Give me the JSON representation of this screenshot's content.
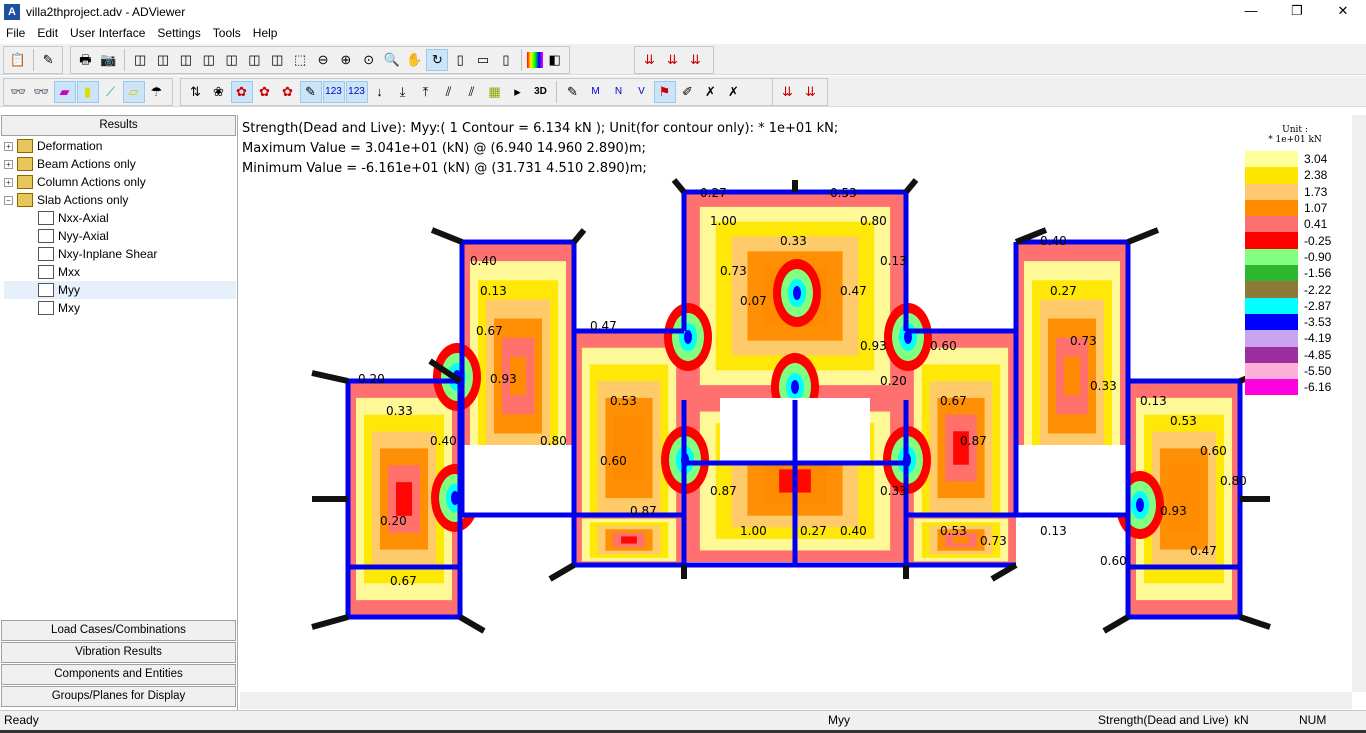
{
  "window": {
    "title": "villa2thproject.adv - ADViewer",
    "minimize": "—",
    "restore": "❐",
    "close": "✕"
  },
  "menu": [
    "File",
    "Edit",
    "User Interface",
    "Settings",
    "Tools",
    "Help"
  ],
  "panel": {
    "results_label": "Results",
    "tree": [
      {
        "label": "Deformation",
        "level": 0
      },
      {
        "label": "Beam Actions only",
        "level": 0
      },
      {
        "label": "Column Actions only",
        "level": 0
      },
      {
        "label": "Slab Actions only",
        "level": 0
      },
      {
        "label": "Nxx-Axial",
        "level": 1
      },
      {
        "label": "Nyy-Axial",
        "level": 1
      },
      {
        "label": "Nxy-Inplane Shear",
        "level": 1
      },
      {
        "label": "Mxx",
        "level": 1
      },
      {
        "label": "Myy",
        "level": 1
      },
      {
        "label": "Mxy",
        "level": 1
      }
    ],
    "bottom_tabs": [
      "Load Cases/Combinations",
      "Vibration Results",
      "Components and Entities",
      "Groups/Planes for Display"
    ]
  },
  "canvas": {
    "header_line1": "Strength(Dead and Live): Myy:( 1 Contour = 6.134 kN ); Unit(for contour only): * 1e+01 kN;",
    "header_line2": "Maximum Value = 3.041e+01 (kN) @ (6.940 14.960 2.890)m;",
    "header_line3": "Minimum Value = -6.161e+01 (kN) @ (31.731 4.510 2.890)m;",
    "legend_title": "Unit :",
    "legend_unit": "* 1e+01 kN",
    "legend": [
      {
        "value": "3.04",
        "color": "#ffff99"
      },
      {
        "value": "2.38",
        "color": "#ffe600"
      },
      {
        "value": "1.73",
        "color": "#ffc870"
      },
      {
        "value": "1.07",
        "color": "#ff8c00"
      },
      {
        "value": "0.41",
        "color": "#ff7070"
      },
      {
        "value": "-0.25",
        "color": "#ff0000"
      },
      {
        "value": "-0.90",
        "color": "#80ff80"
      },
      {
        "value": "-1.56",
        "color": "#2db82d"
      },
      {
        "value": "-2.22",
        "color": "#8b7a38"
      },
      {
        "value": "-2.87",
        "color": "#00ffff"
      },
      {
        "value": "-3.53",
        "color": "#0000ff"
      },
      {
        "value": "-4.19",
        "color": "#c9a4f0"
      },
      {
        "value": "-4.85",
        "color": "#9c2fa0"
      },
      {
        "value": "-5.50",
        "color": "#ffb0d9"
      },
      {
        "value": "-6.16",
        "color": "#ff00e0"
      }
    ],
    "labels": [
      "0.20",
      "0.33",
      "0.40",
      "0.40",
      "0.13",
      "0.67",
      "0.93",
      "0.80",
      "0.47",
      "0.53",
      "0.60",
      "0.87",
      "0.27",
      "1.00",
      "0.73",
      "0.07",
      "0.33",
      "0.53",
      "0.80",
      "0.13",
      "0.47",
      "0.93",
      "0.20",
      "0.60",
      "0.67",
      "0.87",
      "0.40",
      "0.27",
      "0.73",
      "0.33",
      "0.13",
      "0.53",
      "0.60",
      "0.80",
      "0.93",
      "0.47",
      "0.20",
      "0.67",
      "0.87",
      "1.00",
      "0.27",
      "0.40",
      "0.33",
      "0.53",
      "0.73",
      "0.13",
      "0.60"
    ]
  },
  "status": {
    "ready": "Ready",
    "center": "Myy",
    "case": "Strength(Dead and Live)",
    "unit": "kN",
    "num": "NUM"
  },
  "toolbar_icons": [
    "copy-icon",
    "pen-icon",
    "print-icon",
    "camera-icon",
    "view-icon",
    "zoom-out-icon",
    "zoom-in-icon",
    "pan-icon",
    "rotate-icon",
    "color-icon",
    "load-icon"
  ]
}
